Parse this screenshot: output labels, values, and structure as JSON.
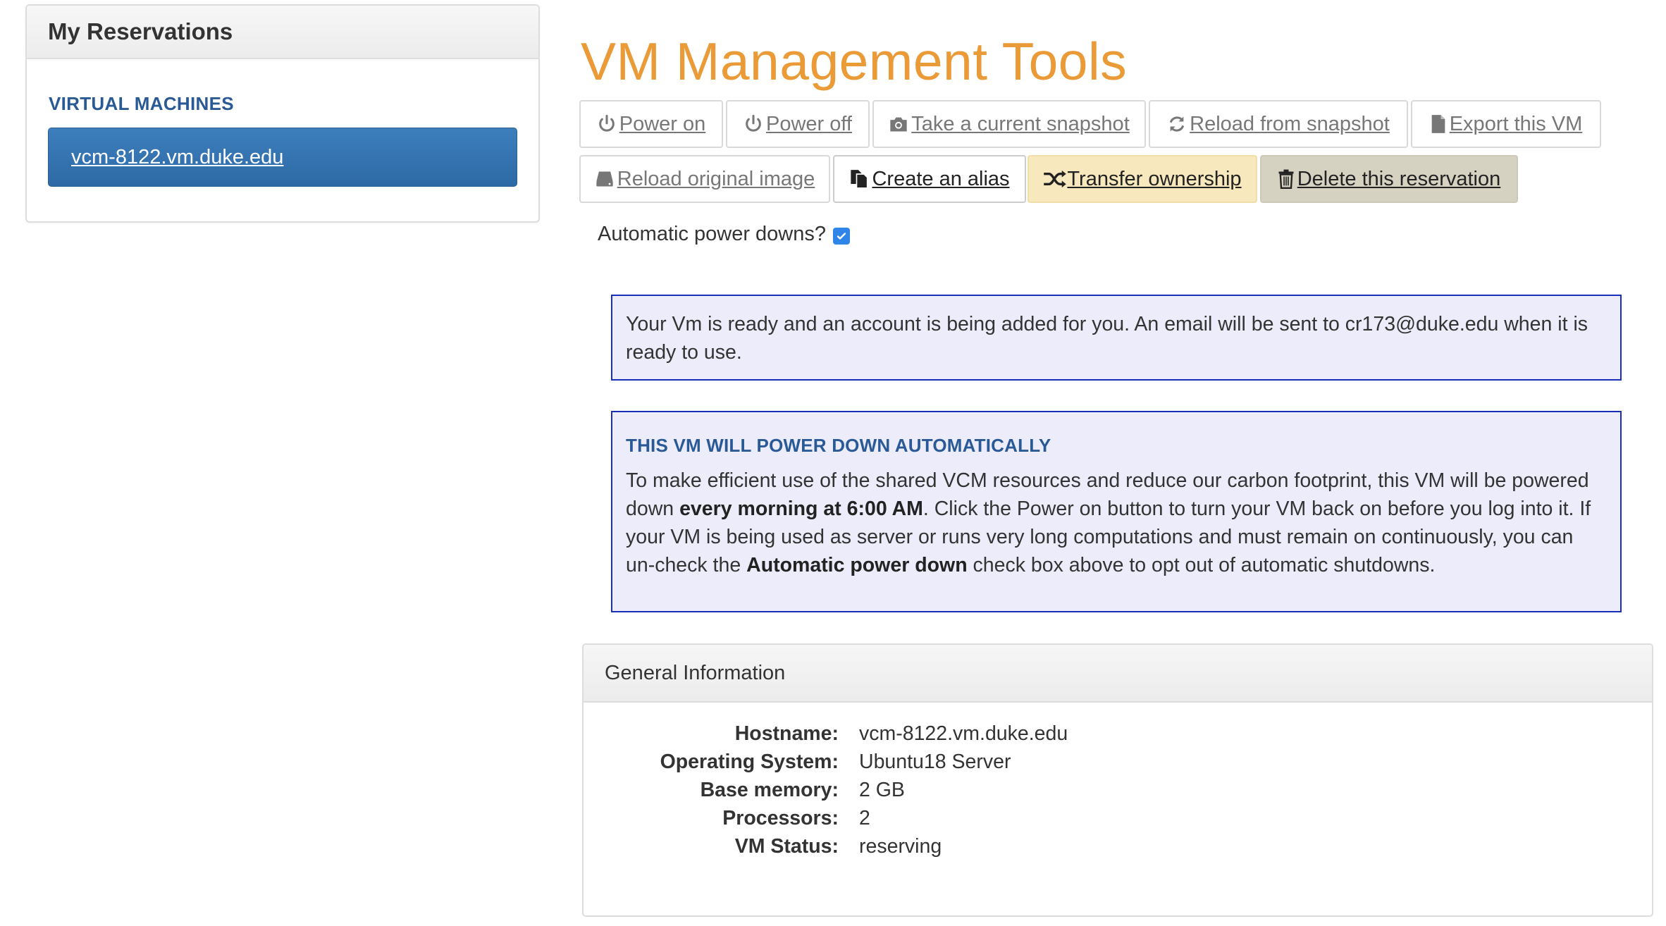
{
  "sidebar": {
    "title": "My Reservations",
    "section_label": "VIRTUAL MACHINES",
    "items": [
      {
        "label": "vcm-8122.vm.duke.edu",
        "active": true
      }
    ]
  },
  "main": {
    "title": "VM Management Tools",
    "buttons_row1": [
      {
        "label": "Power on",
        "icon": "power-icon"
      },
      {
        "label": "Power off",
        "icon": "power-icon"
      },
      {
        "label": "Take a current snapshot",
        "icon": "camera-icon"
      },
      {
        "label": "Reload from snapshot",
        "icon": "refresh-icon"
      },
      {
        "label": "Export this VM",
        "icon": "document-icon"
      }
    ],
    "buttons_row2": [
      {
        "label": "Reload original image",
        "icon": "hard-drive-icon"
      },
      {
        "label": "Create an alias",
        "icon": "copy-icon"
      },
      {
        "label": "Transfer ownership",
        "icon": "shuffle-icon"
      },
      {
        "label": "Delete this reservation",
        "icon": "trash-icon"
      }
    ],
    "auto_power_label": "Automatic power downs?",
    "auto_power_checked": true,
    "alert_ready": {
      "text": "Your Vm is ready and an account is being added for you. An email will be sent to cr173@duke.edu when it is ready to use."
    },
    "alert_power": {
      "heading": "THIS VM WILL POWER DOWN AUTOMATICALLY",
      "text_1": "To make efficient use of the shared VCM resources and reduce our carbon footprint, this VM will be powered down ",
      "bold_1": "every morning at 6:00 AM",
      "text_2": ". Click the Power on button to turn your VM back on before you log into it. If your VM is being used as server or runs very long computations and must remain on continuously, you can un-check the ",
      "bold_2": "Automatic power down",
      "text_3": " check box above to opt out of automatic shutdowns."
    },
    "general_info": {
      "title": "General Information",
      "rows": [
        {
          "label": "Hostname:",
          "value": "vcm-8122.vm.duke.edu"
        },
        {
          "label": "Operating System:",
          "value": "Ubuntu18 Server"
        },
        {
          "label": "Base memory:",
          "value": "2 GB"
        },
        {
          "label": "Processors:",
          "value": "2"
        },
        {
          "label": "VM Status:",
          "value": "reserving"
        }
      ]
    }
  },
  "colors": {
    "title_orange": "#ea9a36",
    "active_blue": "#3373b1",
    "alert_border": "#1a2fb8",
    "alert_bg": "#ececfb",
    "heading_blue": "#2a5a96",
    "transfer_bg": "#f7e8bd",
    "delete_bg": "#d6d2c2"
  }
}
